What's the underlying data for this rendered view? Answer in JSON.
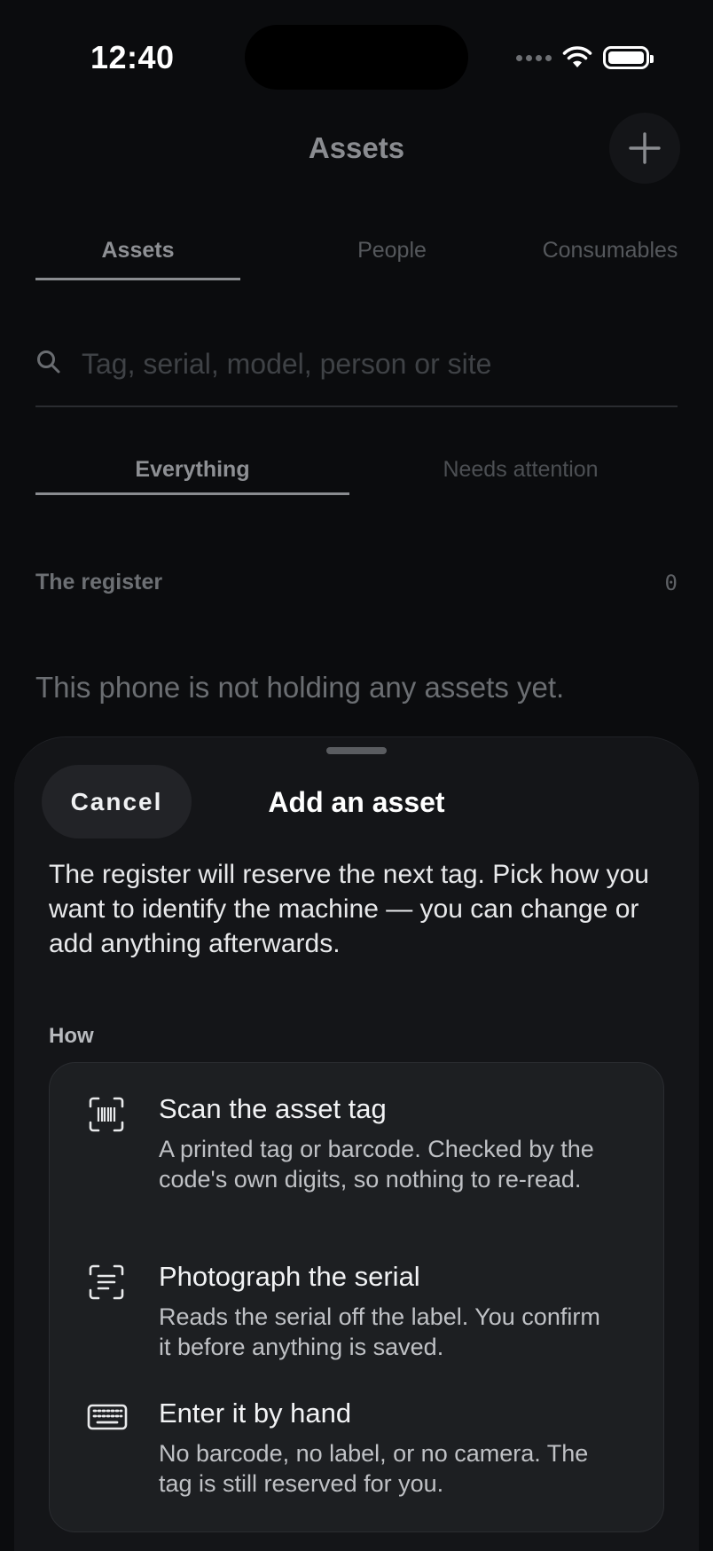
{
  "status_bar": {
    "time": "12:40"
  },
  "header": {
    "title": "Assets",
    "add_icon": "plus-icon"
  },
  "tabs": [
    {
      "label": "Assets",
      "selected": true
    },
    {
      "label": "People",
      "selected": false
    },
    {
      "label": "Consumables",
      "selected": false
    }
  ],
  "search": {
    "placeholder": "Tag, serial, model, person or site",
    "value": ""
  },
  "filter": [
    {
      "label": "Everything",
      "selected": true
    },
    {
      "label": "Needs attention",
      "selected": false
    }
  ],
  "register": {
    "label": "The register",
    "count": "0",
    "empty_message": "This phone is not holding any assets yet."
  },
  "sheet": {
    "cancel_label": "Cancel",
    "title": "Add an asset",
    "description": "The register will reserve the next tag. Pick how you want to identify the machine — you can change or add anything afterwards.",
    "how_label": "How",
    "options": [
      {
        "icon": "barcode-scan-icon",
        "title": "Scan the asset tag",
        "description": "A printed tag or barcode. Checked by the code's own digits, so nothing to re-read."
      },
      {
        "icon": "text-scan-icon",
        "title": "Photograph the serial",
        "description": "Reads the serial off the label. You confirm it before anything is saved."
      },
      {
        "icon": "keyboard-icon",
        "title": "Enter it by hand",
        "description": "No barcode, no label, or no camera. The tag is still reserved for you."
      }
    ]
  },
  "colors": {
    "background": "#0b0c0e",
    "sheet": "#141518",
    "card": "#1d1f22"
  }
}
